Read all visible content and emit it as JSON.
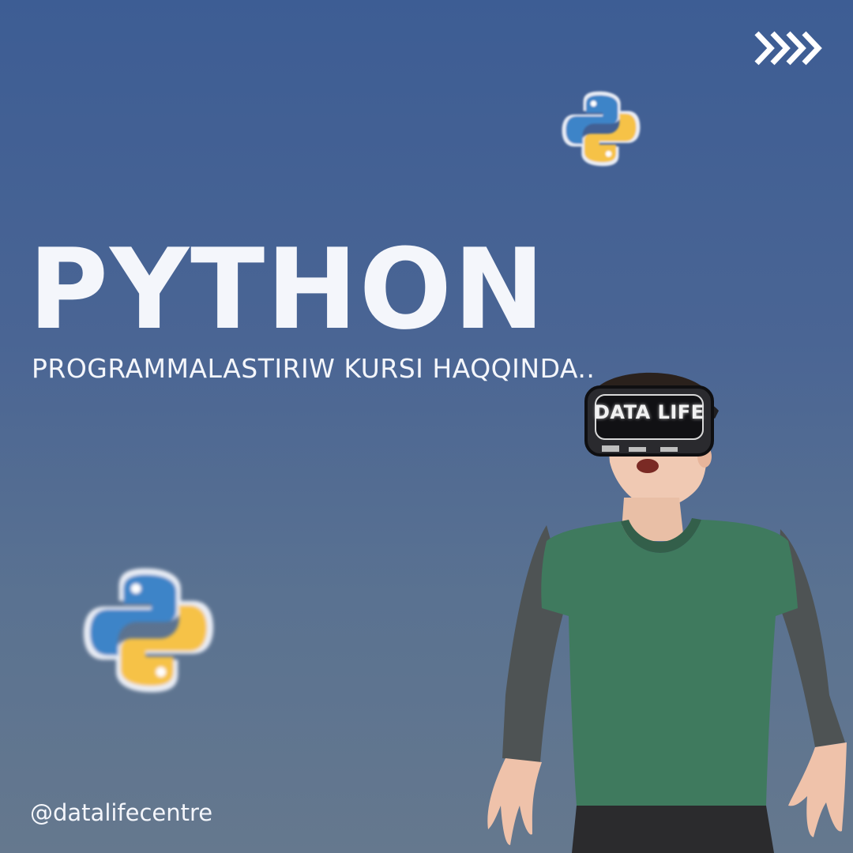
{
  "poster": {
    "title": "PYTHON",
    "subtitle": "PROGRAMMALASTIRIW KURSI HAQQINDA..",
    "handle": "@datalifecentre",
    "headset_label": "DATA LIFE"
  },
  "icons": {
    "next": "chevrons-right-icon",
    "logo": "python-logo-icon"
  },
  "colors": {
    "background_top": "#3d5d94",
    "background_bottom": "#65788e",
    "text": "#f4f6fb",
    "python_blue": "#3e84c8",
    "python_yellow": "#f6c247",
    "shirt": "#3f7a5e"
  }
}
